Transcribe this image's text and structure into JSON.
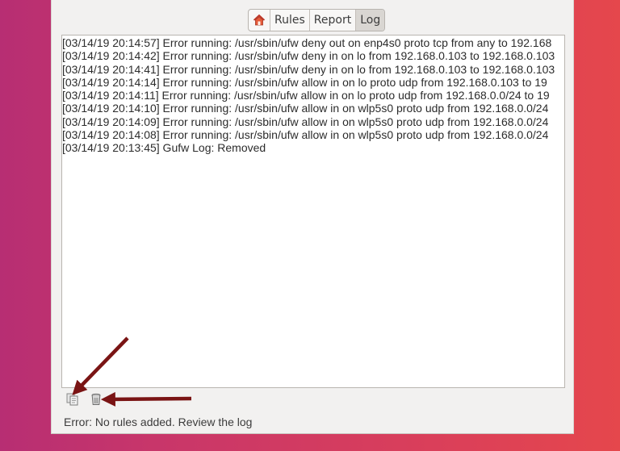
{
  "tabs": [
    {
      "label": "",
      "icon": "home-icon"
    },
    {
      "label": "Rules"
    },
    {
      "label": "Report"
    },
    {
      "label": "Log"
    }
  ],
  "active_tab": "Log",
  "log": {
    "lines": [
      "[03/14/19 20:14:57] Error running: /usr/sbin/ufw deny out on enp4s0 proto tcp from any to 192.168",
      "[03/14/19 20:14:42] Error running: /usr/sbin/ufw deny in on lo from 192.168.0.103  to 192.168.0.103",
      "[03/14/19 20:14:41] Error running: /usr/sbin/ufw deny in on lo from 192.168.0.103  to 192.168.0.103",
      "[03/14/19 20:14:14] Error running: /usr/sbin/ufw allow in on lo proto udp from 192.168.0.103  to 19",
      "[03/14/19 20:14:11] Error running: /usr/sbin/ufw allow in on lo proto udp from 192.168.0.0/24 to 19",
      "[03/14/19 20:14:10] Error running: /usr/sbin/ufw allow in on wlp5s0 proto udp from 192.168.0.0/24",
      "[03/14/19 20:14:09] Error running: /usr/sbin/ufw allow in on wlp5s0 proto udp from 192.168.0.0/24",
      "[03/14/19 20:14:08] Error running: /usr/sbin/ufw allow in on wlp5s0 proto udp from 192.168.0.0/24",
      "[03/14/19 20:13:45] Gufw Log: Removed"
    ]
  },
  "bottom_icons": [
    "copy-icon",
    "trash-icon"
  ],
  "status": "Error: No rules added. Review the log",
  "colors": {
    "arrow": "#7a1414"
  }
}
